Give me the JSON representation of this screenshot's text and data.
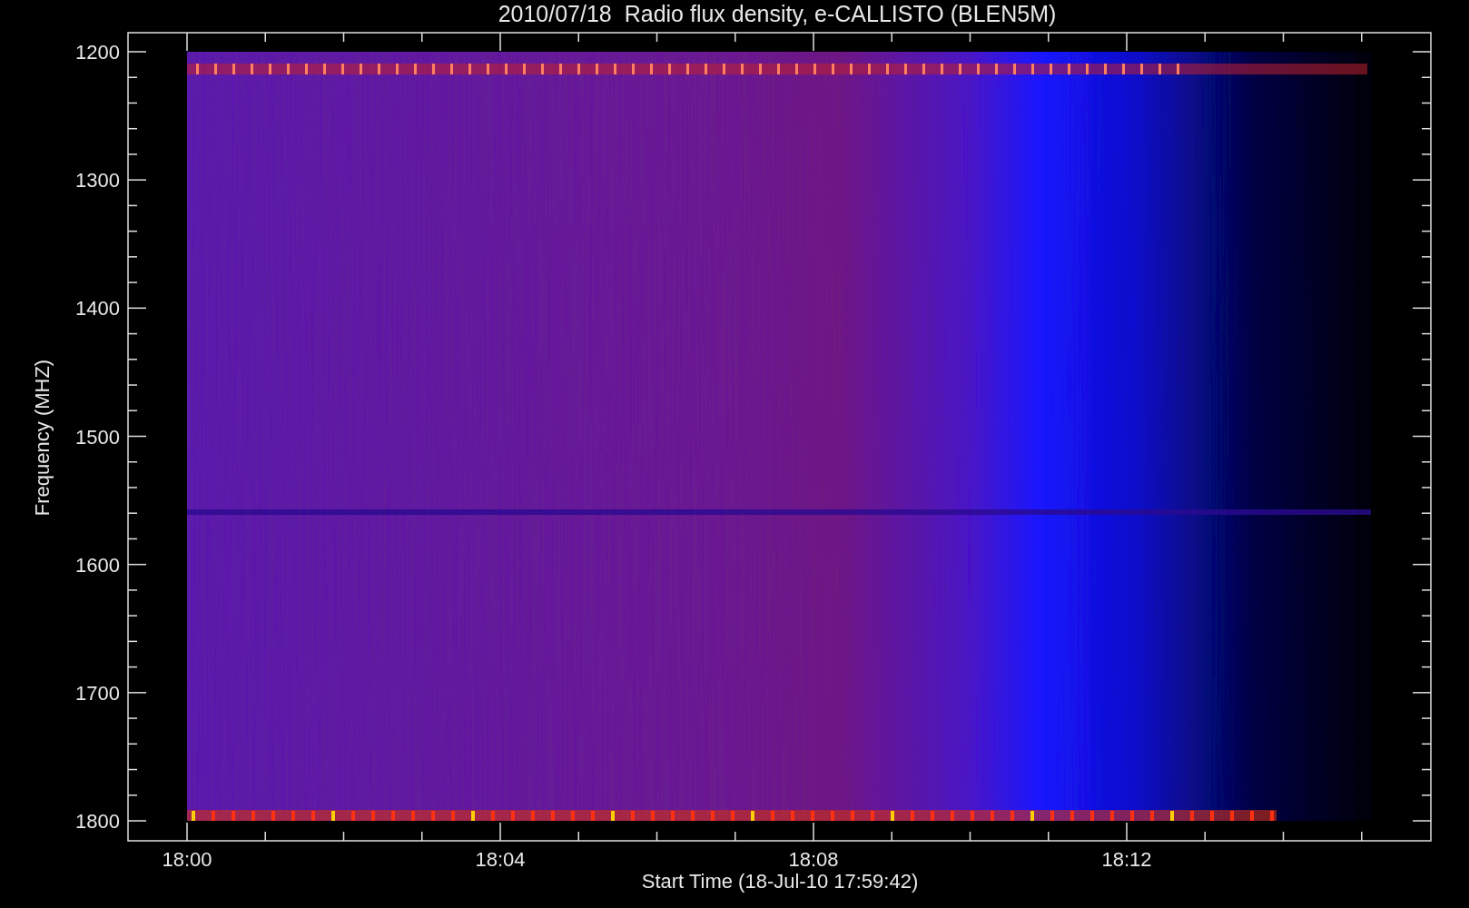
{
  "title": "2010/07/18  Radio flux density, e-CALLISTO (BLEN5M)",
  "ylabel": "Frequency (MHZ)",
  "xlabel": "Start Time (18-Jul-10 17:59:42)",
  "yticks": [
    "1200",
    "1300",
    "1400",
    "1500",
    "1600",
    "1700",
    "1800"
  ],
  "xticks": [
    "18:00",
    "18:04",
    "18:08",
    "18:12"
  ]
}
